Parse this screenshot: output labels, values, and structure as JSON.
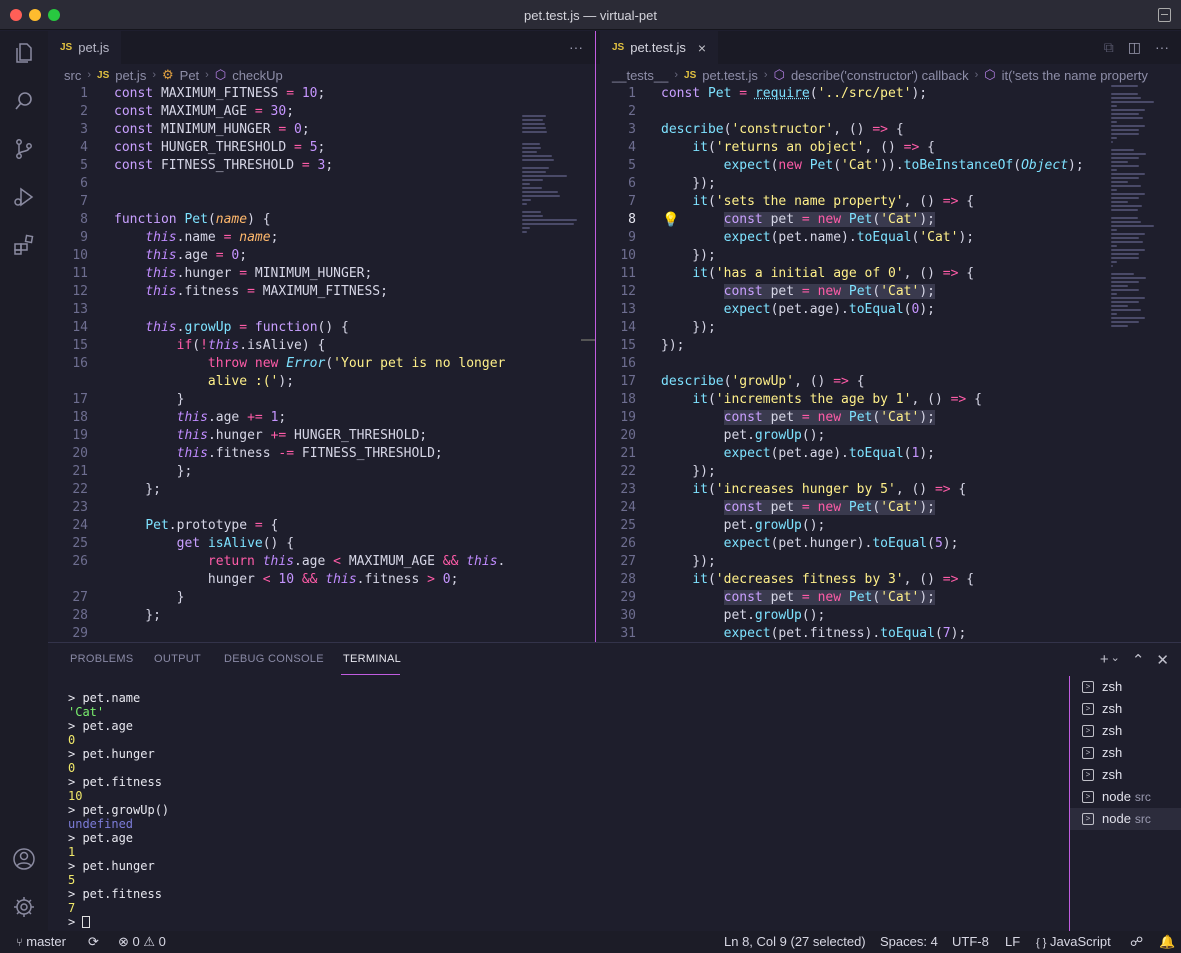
{
  "window": {
    "title": "pet.test.js — virtual-pet"
  },
  "left_editor": {
    "tab": {
      "label": "pet.js",
      "badge": "JS"
    },
    "more_actions": "···",
    "breadcrumb": [
      "src",
      "pet.js",
      "Pet",
      "checkUp"
    ],
    "lines": [
      {
        "n": "1",
        "html": "<span class=\"decl\">const</span> MAXIMUM_FITNESS <span class=\"op\">=</span> <span class=\"num\">10</span>;"
      },
      {
        "n": "2",
        "html": "<span class=\"decl\">const</span> MAXIMUM_AGE <span class=\"op\">=</span> <span class=\"num\">30</span>;"
      },
      {
        "n": "3",
        "html": "<span class=\"decl\">const</span> MINIMUM_HUNGER <span class=\"op\">=</span> <span class=\"num\">0</span>;"
      },
      {
        "n": "4",
        "html": "<span class=\"decl\">const</span> HUNGER_THRESHOLD <span class=\"op\">=</span> <span class=\"num\">5</span>;"
      },
      {
        "n": "5",
        "html": "<span class=\"decl\">const</span> FITNESS_THRESHOLD <span class=\"op\">=</span> <span class=\"num\">3</span>;"
      },
      {
        "n": "6",
        "html": ""
      },
      {
        "n": "7",
        "html": ""
      },
      {
        "n": "8",
        "html": "<span class=\"decl\">function</span> <span class=\"fn\">Pet</span>(<span class=\"param\">name</span>) {"
      },
      {
        "n": "9",
        "html": "    <span class=\"thisk\">this</span>.name <span class=\"op\">=</span> <span class=\"param\">name</span>;"
      },
      {
        "n": "10",
        "html": "    <span class=\"thisk\">this</span>.age <span class=\"op\">=</span> <span class=\"num\">0</span>;"
      },
      {
        "n": "11",
        "html": "    <span class=\"thisk\">this</span>.hunger <span class=\"op\">=</span> MINIMUM_HUNGER;"
      },
      {
        "n": "12",
        "html": "    <span class=\"thisk\">this</span>.fitness <span class=\"op\">=</span> MAXIMUM_FITNESS;"
      },
      {
        "n": "13",
        "html": ""
      },
      {
        "n": "14",
        "html": "    <span class=\"thisk\">this</span>.<span class=\"fn\">growUp</span> <span class=\"op\">=</span> <span class=\"decl\">function</span>() {"
      },
      {
        "n": "15",
        "html": "        <span class=\"kw\">if</span>(<span class=\"op\">!</span><span class=\"thisk\">this</span>.isAlive) {"
      },
      {
        "n": "16",
        "html": "            <span class=\"kw\">throw</span> <span class=\"kw\">new</span> <span class=\"cls\">Error</span>(<span class=\"str\">'Your pet is no longer</span>"
      },
      {
        "n": "",
        "html": "            <span class=\"str\">alive :('</span>);"
      },
      {
        "n": "17",
        "html": "        }"
      },
      {
        "n": "18",
        "html": "        <span class=\"thisk\">this</span>.age <span class=\"op\">+=</span> <span class=\"num\">1</span>;"
      },
      {
        "n": "19",
        "html": "        <span class=\"thisk\">this</span>.hunger <span class=\"op\">+=</span> HUNGER_THRESHOLD;"
      },
      {
        "n": "20",
        "html": "        <span class=\"thisk\">this</span>.fitness <span class=\"op\">-=</span> FITNESS_THRESHOLD;"
      },
      {
        "n": "21",
        "html": "        };"
      },
      {
        "n": "22",
        "html": "    };"
      },
      {
        "n": "23",
        "html": ""
      },
      {
        "n": "24",
        "html": "    <span class=\"fn\">Pet</span>.prototype <span class=\"op\">=</span> {"
      },
      {
        "n": "25",
        "html": "        <span class=\"decl\">get</span> <span class=\"fn\">isAlive</span>() {"
      },
      {
        "n": "26",
        "html": "            <span class=\"kw\">return</span> <span class=\"thisk\">this</span>.age <span class=\"op\">&lt;</span> MAXIMUM_AGE <span class=\"op\">&amp;&amp;</span> <span class=\"thisk\">this</span>."
      },
      {
        "n": "",
        "html": "            hunger <span class=\"op\">&lt;</span> <span class=\"num\">10</span> <span class=\"op\">&amp;&amp;</span> <span class=\"thisk\">this</span>.fitness <span class=\"op\">&gt;</span> <span class=\"num\">0</span>;"
      },
      {
        "n": "27",
        "html": "        }"
      },
      {
        "n": "28",
        "html": "    };"
      },
      {
        "n": "29",
        "html": ""
      }
    ]
  },
  "right_editor": {
    "tab": {
      "label": "pet.test.js",
      "badge": "JS",
      "close": "×"
    },
    "breadcrumb": [
      "__tests__",
      "pet.test.js",
      "describe('constructor') callback",
      "it('sets the name property"
    ],
    "active_line": "8",
    "lines": [
      {
        "n": "1",
        "html": "<span class=\"decl\">const</span> <span class=\"fn\">Pet</span> <span class=\"op\">=</span> <span class=\"fn\" style=\"text-decoration:underline dotted\">require</span>(<span class=\"str\">'../src/pet'</span>);"
      },
      {
        "n": "2",
        "html": ""
      },
      {
        "n": "3",
        "html": "<span class=\"fn\">describe</span>(<span class=\"str\">'constructor'</span>, () <span class=\"op\">=&gt;</span> {"
      },
      {
        "n": "4",
        "html": "    <span class=\"fn\">it</span>(<span class=\"str\">'returns an object'</span>, () <span class=\"op\">=&gt;</span> {"
      },
      {
        "n": "5",
        "html": "        <span class=\"fn\">expect</span>(<span class=\"kw\">new</span> <span class=\"fn\">Pet</span>(<span class=\"str\">'Cat'</span>)).<span class=\"fn\">toBeInstanceOf</span>(<span class=\"cls\">Object</span>);"
      },
      {
        "n": "6",
        "html": "    });"
      },
      {
        "n": "7",
        "html": "    <span class=\"fn\">it</span>(<span class=\"str\">'sets the name property'</span>, () <span class=\"op\">=&gt;</span> {"
      },
      {
        "n": "8",
        "html": "        <span class=\"hl\"><span class=\"decl\">const</span> pet <span class=\"op\">=</span> <span class=\"kw\">new</span> <span class=\"fn\">Pet</span>(<span class=\"str\">'Cat'</span>);</span>"
      },
      {
        "n": "9",
        "html": "        <span class=\"fn\">expect</span>(pet.name).<span class=\"fn\">toEqual</span>(<span class=\"str\">'Cat'</span>);"
      },
      {
        "n": "10",
        "html": "    });"
      },
      {
        "n": "11",
        "html": "    <span class=\"fn\">it</span>(<span class=\"str\">'has a initial age of 0'</span>, () <span class=\"op\">=&gt;</span> {"
      },
      {
        "n": "12",
        "html": "        <span class=\"hl\"><span class=\"decl\">const</span> pet <span class=\"op\">=</span> <span class=\"kw\">new</span> <span class=\"fn\">Pet</span>(<span class=\"str\">'Cat'</span>);</span>"
      },
      {
        "n": "13",
        "html": "        <span class=\"fn\">expect</span>(pet.age).<span class=\"fn\">toEqual</span>(<span class=\"num\">0</span>);"
      },
      {
        "n": "14",
        "html": "    });"
      },
      {
        "n": "15",
        "html": "});"
      },
      {
        "n": "16",
        "html": ""
      },
      {
        "n": "17",
        "html": "<span class=\"fn\">describe</span>(<span class=\"str\">'growUp'</span>, () <span class=\"op\">=&gt;</span> {"
      },
      {
        "n": "18",
        "html": "    <span class=\"fn\">it</span>(<span class=\"str\">'increments the age by 1'</span>, () <span class=\"op\">=&gt;</span> {"
      },
      {
        "n": "19",
        "html": "        <span class=\"hl\"><span class=\"decl\">const</span> pet <span class=\"op\">=</span> <span class=\"kw\">new</span> <span class=\"fn\">Pet</span>(<span class=\"str\">'Cat'</span>);</span>"
      },
      {
        "n": "20",
        "html": "        pet.<span class=\"fn\">growUp</span>();"
      },
      {
        "n": "21",
        "html": "        <span class=\"fn\">expect</span>(pet.age).<span class=\"fn\">toEqual</span>(<span class=\"num\">1</span>);"
      },
      {
        "n": "22",
        "html": "    });"
      },
      {
        "n": "23",
        "html": "    <span class=\"fn\">it</span>(<span class=\"str\">'increases hunger by 5'</span>, () <span class=\"op\">=&gt;</span> {"
      },
      {
        "n": "24",
        "html": "        <span class=\"hl\"><span class=\"decl\">const</span> pet <span class=\"op\">=</span> <span class=\"kw\">new</span> <span class=\"fn\">Pet</span>(<span class=\"str\">'Cat'</span>);</span>"
      },
      {
        "n": "25",
        "html": "        pet.<span class=\"fn\">growUp</span>();"
      },
      {
        "n": "26",
        "html": "        <span class=\"fn\">expect</span>(pet.hunger).<span class=\"fn\">toEqual</span>(<span class=\"num\">5</span>);"
      },
      {
        "n": "27",
        "html": "    });"
      },
      {
        "n": "28",
        "html": "    <span class=\"fn\">it</span>(<span class=\"str\">'decreases fitness by 3'</span>, () <span class=\"op\">=&gt;</span> {"
      },
      {
        "n": "29",
        "html": "        <span class=\"hl\"><span class=\"decl\">const</span> pet <span class=\"op\">=</span> <span class=\"kw\">new</span> <span class=\"fn\">Pet</span>(<span class=\"str\">'Cat'</span>);</span>"
      },
      {
        "n": "30",
        "html": "        pet.<span class=\"fn\">growUp</span>();"
      },
      {
        "n": "31",
        "html": "        <span class=\"fn\">expect</span>(pet.fitness).<span class=\"fn\">toEqual</span>(<span class=\"num\">7</span>);"
      }
    ]
  },
  "panel": {
    "tabs": [
      "PROBLEMS",
      "OUTPUT",
      "DEBUG CONSOLE",
      "TERMINAL"
    ],
    "active_tab": "TERMINAL",
    "actions": {
      "add": "+",
      "dropdown": "⌄",
      "maximize": "⌃",
      "close": "✕"
    },
    "terminal_lines": [
      {
        "cls": "prompt",
        "text": "> pet.name"
      },
      {
        "cls": "out-str",
        "text": "'Cat'"
      },
      {
        "cls": "prompt",
        "text": "> pet.age"
      },
      {
        "cls": "out-num",
        "text": "0"
      },
      {
        "cls": "prompt",
        "text": "> pet.hunger"
      },
      {
        "cls": "out-num",
        "text": "0"
      },
      {
        "cls": "prompt",
        "text": "> pet.fitness"
      },
      {
        "cls": "out-num",
        "text": "10"
      },
      {
        "cls": "prompt",
        "text": "> pet.growUp()"
      },
      {
        "cls": "out-undef",
        "text": "undefined"
      },
      {
        "cls": "prompt",
        "text": "> pet.age"
      },
      {
        "cls": "out-num",
        "text": "1"
      },
      {
        "cls": "prompt",
        "text": "> pet.hunger"
      },
      {
        "cls": "out-num",
        "text": "5"
      },
      {
        "cls": "prompt",
        "text": "> pet.fitness"
      },
      {
        "cls": "out-num",
        "text": "7"
      }
    ],
    "prompt_symbol": ">",
    "terminals": [
      {
        "name": "zsh",
        "sub": ""
      },
      {
        "name": "zsh",
        "sub": ""
      },
      {
        "name": "zsh",
        "sub": ""
      },
      {
        "name": "zsh",
        "sub": ""
      },
      {
        "name": "zsh",
        "sub": ""
      },
      {
        "name": "node",
        "sub": "src"
      },
      {
        "name": "node",
        "sub": "src"
      }
    ]
  },
  "statusbar": {
    "branch": "master",
    "sync": "⟳",
    "errors": "0",
    "warnings": "0",
    "cursor": "Ln 8, Col 9 (27 selected)",
    "spaces": "Spaces: 4",
    "encoding": "UTF-8",
    "eol": "LF",
    "language": "JavaScript",
    "lang_icon": "{ }"
  },
  "colors": {
    "accent": "#c15ce0",
    "close": "#ff5f57",
    "minimize": "#febc2e",
    "zoom": "#28c840"
  }
}
